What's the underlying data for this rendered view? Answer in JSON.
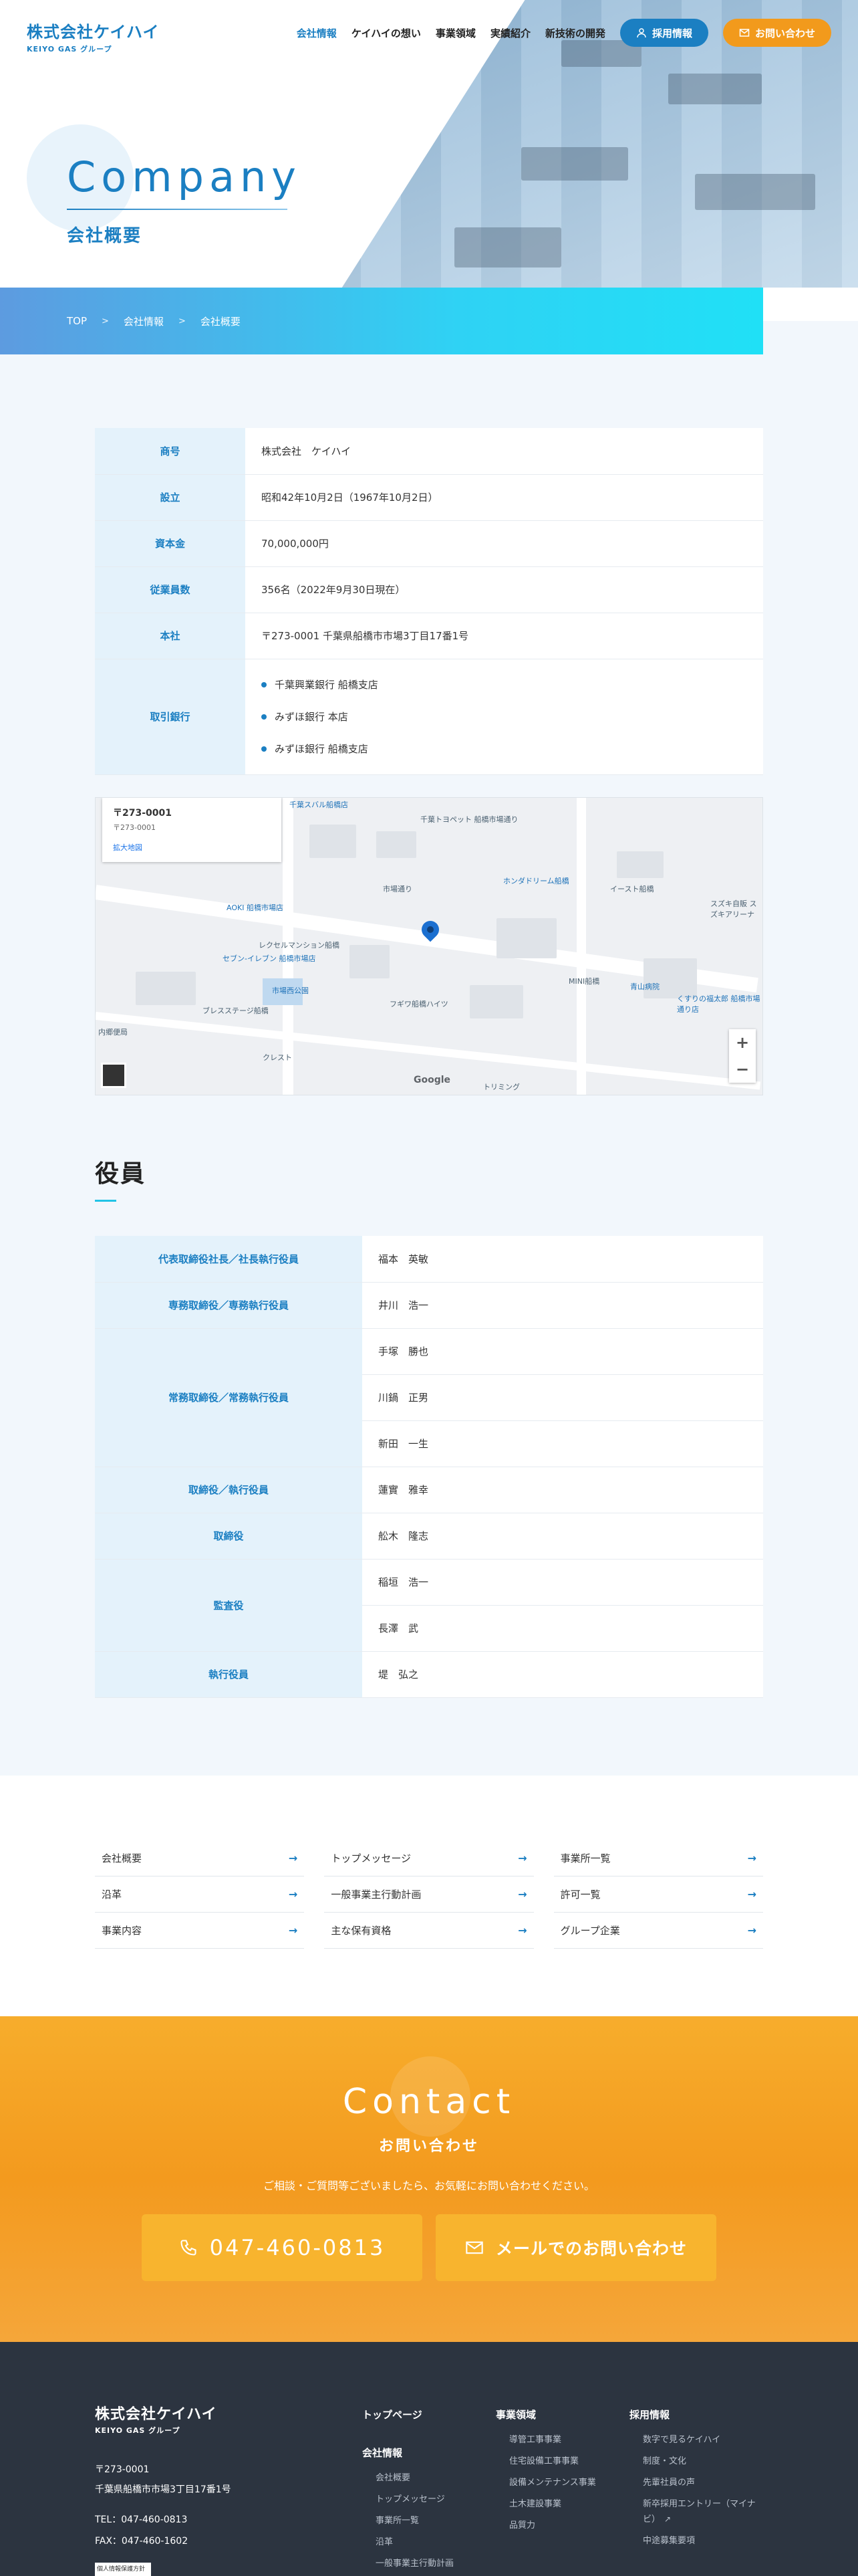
{
  "header": {
    "logo_main": "株式会社ケイハイ",
    "logo_sub": "KEIYO GAS グループ",
    "nav": [
      "会社情報",
      "ケイハイの想い",
      "事業領域",
      "実績紹介",
      "新技術の開発"
    ],
    "recruit_label": "採用情報",
    "contact_label": "お問い合わせ"
  },
  "hero": {
    "title": "Company",
    "subtitle": "会社概要"
  },
  "breadcrumb": [
    "TOP",
    "会社情報",
    "会社概要"
  ],
  "company": {
    "rows": [
      {
        "label": "商号",
        "value": "株式会社　ケイハイ"
      },
      {
        "label": "設立",
        "value": "昭和42年10月2日（1967年10月2日）"
      },
      {
        "label": "資本金",
        "value": "70,000,000円"
      },
      {
        "label": "従業員数",
        "value": "356名（2022年9月30日現在）"
      },
      {
        "label": "本社",
        "value": "〒273-0001 千葉県船橋市市場3丁目17番1号"
      }
    ],
    "bank_label": "取引銀行",
    "banks": [
      "千葉興業銀行 船橋支店",
      "みずほ銀行 本店",
      "みずほ銀行 船橋支店"
    ]
  },
  "map": {
    "card_title": "〒273-0001",
    "card_sub": "〒273-0001",
    "card_link": "拡大地図",
    "google": "Google",
    "labels": [
      "千葉スバル船橋店",
      "市場通り",
      "ホンダドリーム船橋",
      "AOKI 船橋市場店",
      "セブン-イレブン 船橋市場店",
      "市場西公園",
      "レクセルマンション船橋",
      "フギワ船橋ハイツ",
      "ブレスステージ船橋",
      "クレスト",
      "青山病院",
      "くすりの福太郎 船橋市場通り店",
      "トリミング",
      "内郷便局",
      "イースト船橋",
      "MINI船橋",
      "スズキ自販 スズキアリーナ",
      "千葉トヨペット 船橋市場通り"
    ]
  },
  "officers": {
    "title": "役員",
    "rows": [
      {
        "label": "代表取締役社長／社長執行役員",
        "names": [
          "福本　英敏"
        ]
      },
      {
        "label": "専務取締役／専務執行役員",
        "names": [
          "井川　浩一"
        ]
      },
      {
        "label": "常務取締役／常務執行役員",
        "names": [
          "手塚　勝也",
          "川鍋　正男",
          "新田　一生"
        ]
      },
      {
        "label": "取締役／執行役員",
        "names": [
          "蓮實　雅幸"
        ]
      },
      {
        "label": "取締役",
        "names": [
          "舩木　隆志"
        ]
      },
      {
        "label": "監査役",
        "names": [
          "稲垣　浩一",
          "長澤　武"
        ]
      },
      {
        "label": "執行役員",
        "names": [
          "堤　弘之"
        ]
      }
    ]
  },
  "links": [
    "会社概要",
    "トップメッセージ",
    "事業所一覧",
    "沿革",
    "一般事業主行動計画",
    "許可一覧",
    "事業内容",
    "主な保有資格",
    "グループ企業"
  ],
  "contact": {
    "title": "Contact",
    "subtitle": "お問い合わせ",
    "desc": "ご相談・ご質問等ございましたら、お気軽にお問い合わせください。",
    "tel": "047-460-0813",
    "mail": "メールでのお問い合わせ"
  },
  "footer": {
    "logo_main": "株式会社ケイハイ",
    "logo_sub": "KEIYO GAS グループ",
    "postal": "〒273-0001",
    "address": "千葉県船橋市市場3丁目17番1号",
    "tel": "TEL：047-460-0813",
    "fax": "FAX：047-460-1602",
    "badge": "個人情報保護方針",
    "col1_top": "トップページ",
    "col1_head": "会社情報",
    "col1_items": [
      "会社概要",
      "トップメッセージ",
      "事業所一覧",
      "沿革",
      "一般事業主行動計画"
    ],
    "col2_head": "事業領域",
    "col2_items": [
      "導管工事事業",
      "住宅設備工事事業",
      "設備メンテナンス事業",
      "土木建設事業",
      "品質力"
    ],
    "col3_head": "採用情報",
    "col3_items": [
      "数字で見るケイハイ",
      "制度・文化",
      "先輩社員の声",
      "新卒採用エントリー（マイナビ）",
      "中途募集要項"
    ]
  },
  "colors": {
    "brand": "#1b7fc2",
    "accent": "#f29a1c",
    "cyan": "#22c4e6"
  }
}
